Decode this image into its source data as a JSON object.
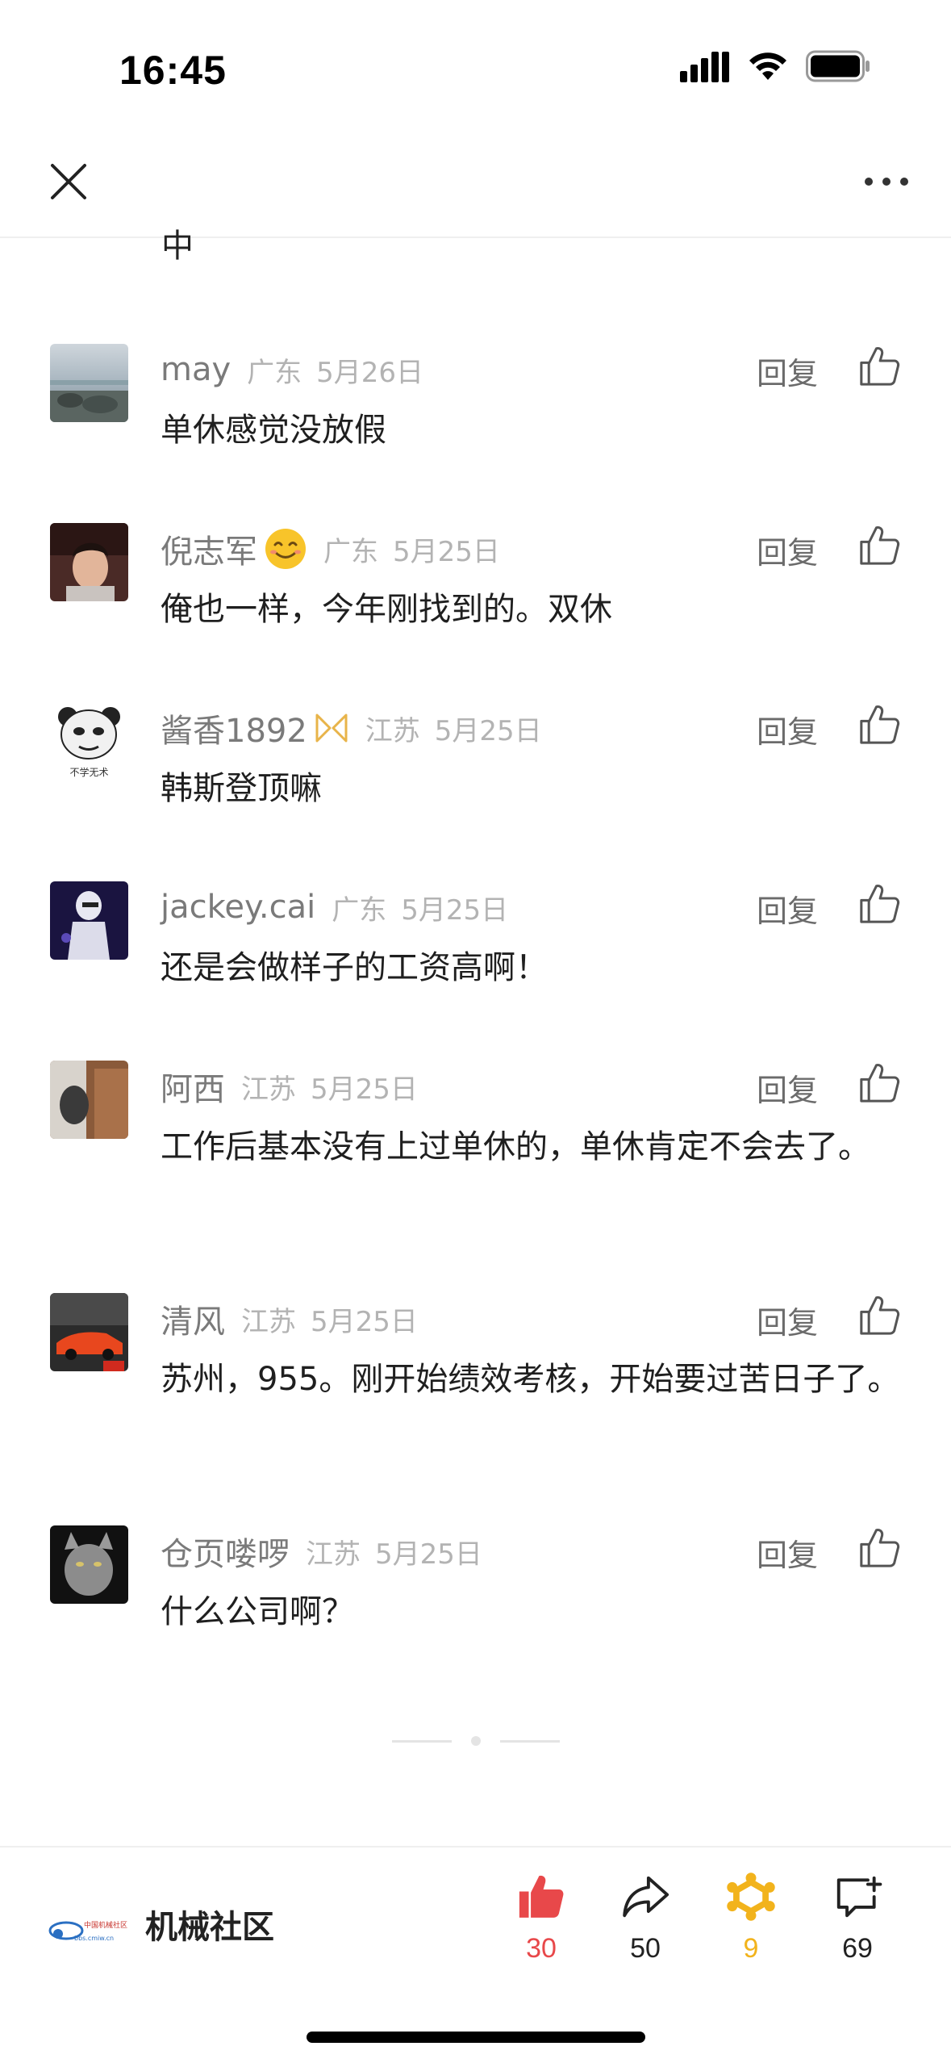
{
  "status_bar": {
    "time": "16:45"
  },
  "partial_text": "中",
  "comments": [
    {
      "name": "may",
      "location": "广东",
      "date": "5月26日",
      "reply": "回复",
      "text": "单休感觉没放假"
    },
    {
      "name": "倪志军",
      "location": "广东",
      "date": "5月25日",
      "reply": "回复",
      "text": "俺也一样，今年刚找到的。双休"
    },
    {
      "name": "酱香1892",
      "location": "江苏",
      "date": "5月25日",
      "reply": "回复",
      "text": "韩斯登顶嘛"
    },
    {
      "name": "jackey.cai",
      "location": "广东",
      "date": "5月25日",
      "reply": "回复",
      "text": "还是会做样子的工资高啊！"
    },
    {
      "name": "阿西",
      "location": "江苏",
      "date": "5月25日",
      "reply": "回复",
      "text": "工作后基本没有上过单休的，单休肯定不会去了。"
    },
    {
      "name": "清风",
      "location": "江苏",
      "date": "5月25日",
      "reply": "回复",
      "text": "苏州，955。刚开始绩效考核，开始要过苦日子了。"
    },
    {
      "name": "仓页喽啰",
      "location": "江苏",
      "date": "5月25日",
      "reply": "回复",
      "text": "什么公司啊？"
    }
  ],
  "avatar_badges": {
    "avatar_2": "不学无术"
  },
  "bottom_bar": {
    "brand_name": "机械社区",
    "logo_text": "中国机械社区",
    "logo_url_text": "bbs.cmiw.cn",
    "like_count": "30",
    "share_count": "50",
    "collect_count": "9",
    "comment_count": "69"
  },
  "colors": {
    "like_red": "#e8484a",
    "collect_gold": "#f2b31c",
    "meta_gray": "#b3b3b3",
    "name_gray": "#7a7a7a"
  },
  "icons": [
    "close-icon",
    "more-icon",
    "like-icon",
    "share-icon",
    "collect-icon",
    "comment-add-icon",
    "smiley-emoji-icon",
    "ribbon-badge-icon",
    "signal-icon",
    "wifi-icon",
    "battery-icon"
  ]
}
